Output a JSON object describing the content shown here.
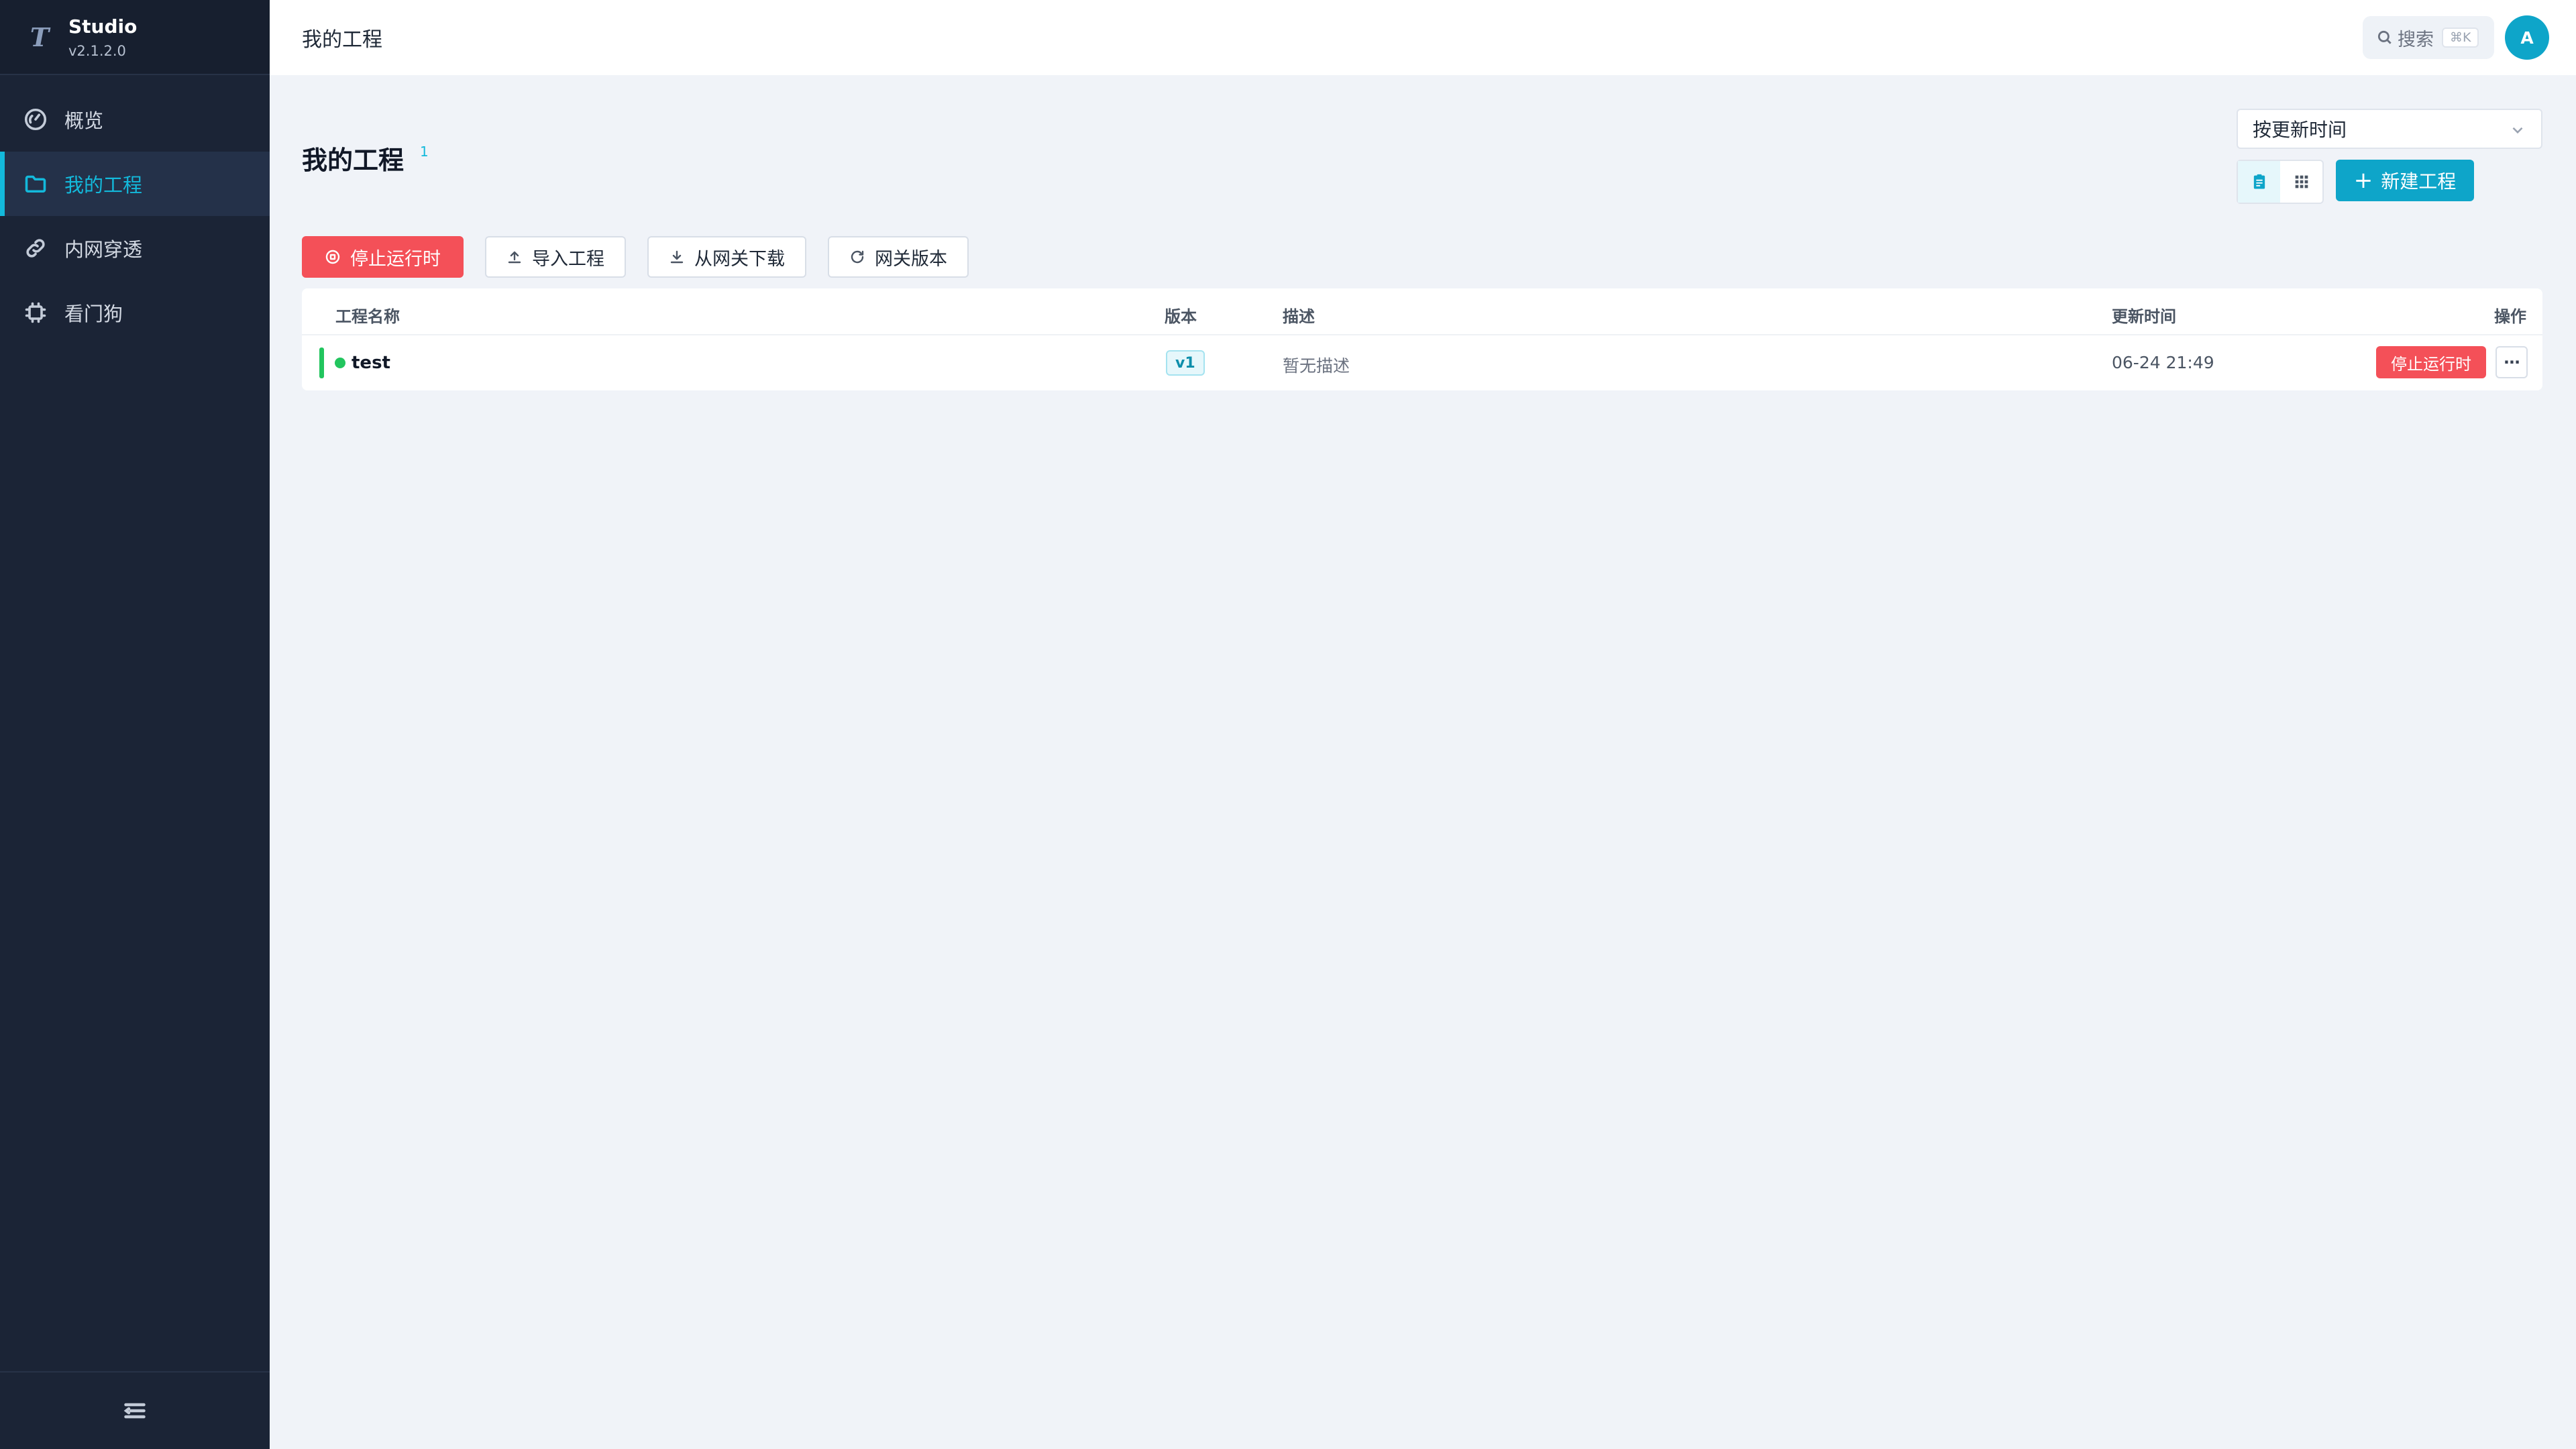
{
  "brand": {
    "name": "Studio",
    "version": "v2.1.2.0",
    "logo_letter": "T"
  },
  "sidebar": {
    "items": [
      {
        "label": "概览",
        "icon": "gauge-icon",
        "active": false
      },
      {
        "label": "我的工程",
        "icon": "folder-icon",
        "active": true
      },
      {
        "label": "内网穿透",
        "icon": "link-icon",
        "active": false
      },
      {
        "label": "看门狗",
        "icon": "chip-icon",
        "active": false
      }
    ],
    "collapse_icon": "menu-collapse-icon"
  },
  "header": {
    "breadcrumb": "我的工程",
    "search_label": "搜索",
    "search_shortcut": "⌘K",
    "avatar_letter": "A"
  },
  "main": {
    "title": "我的工程",
    "count": "1",
    "sort_label": "按更新时间",
    "new_button": "新建工程",
    "toolbar": {
      "stop_runtime": "停止运行时",
      "import": "导入工程",
      "download": "从网关下载",
      "gateway_version": "网关版本"
    },
    "table": {
      "columns": {
        "name": "工程名称",
        "version": "版本",
        "desc": "描述",
        "updated": "更新时间",
        "actions": "操作"
      },
      "rows": [
        {
          "name": "test",
          "version": "v1",
          "desc": "暂无描述",
          "updated": "06-24 21:49",
          "action": "停止运行时",
          "more": "···",
          "status": "running"
        }
      ]
    }
  },
  "colors": {
    "accent": "#0ea5c9",
    "danger": "#f45058",
    "running": "#22c55e",
    "sidebar": "#1b2436"
  }
}
